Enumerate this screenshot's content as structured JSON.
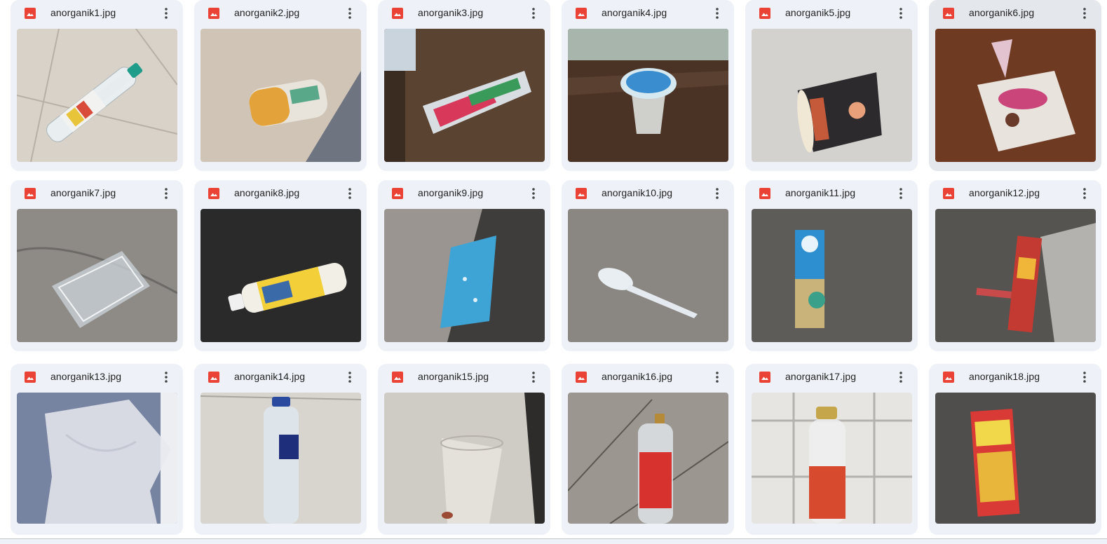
{
  "files": [
    {
      "name": "anorganik1.jpg",
      "icon": "image-file-icon",
      "menu_icon": "more-vert-icon"
    },
    {
      "name": "anorganik2.jpg",
      "icon": "image-file-icon",
      "menu_icon": "more-vert-icon"
    },
    {
      "name": "anorganik3.jpg",
      "icon": "image-file-icon",
      "menu_icon": "more-vert-icon"
    },
    {
      "name": "anorganik4.jpg",
      "icon": "image-file-icon",
      "menu_icon": "more-vert-icon"
    },
    {
      "name": "anorganik5.jpg",
      "icon": "image-file-icon",
      "menu_icon": "more-vert-icon"
    },
    {
      "name": "anorganik6.jpg",
      "icon": "image-file-icon",
      "menu_icon": "more-vert-icon"
    },
    {
      "name": "anorganik7.jpg",
      "icon": "image-file-icon",
      "menu_icon": "more-vert-icon"
    },
    {
      "name": "anorganik8.jpg",
      "icon": "image-file-icon",
      "menu_icon": "more-vert-icon"
    },
    {
      "name": "anorganik9.jpg",
      "icon": "image-file-icon",
      "menu_icon": "more-vert-icon"
    },
    {
      "name": "anorganik10.jpg",
      "icon": "image-file-icon",
      "menu_icon": "more-vert-icon"
    },
    {
      "name": "anorganik11.jpg",
      "icon": "image-file-icon",
      "menu_icon": "more-vert-icon"
    },
    {
      "name": "anorganik12.jpg",
      "icon": "image-file-icon",
      "menu_icon": "more-vert-icon"
    },
    {
      "name": "anorganik13.jpg",
      "icon": "image-file-icon",
      "menu_icon": "more-vert-icon"
    },
    {
      "name": "anorganik14.jpg",
      "icon": "image-file-icon",
      "menu_icon": "more-vert-icon"
    },
    {
      "name": "anorganik15.jpg",
      "icon": "image-file-icon",
      "menu_icon": "more-vert-icon"
    },
    {
      "name": "anorganik16.jpg",
      "icon": "image-file-icon",
      "menu_icon": "more-vert-icon"
    },
    {
      "name": "anorganik17.jpg",
      "icon": "image-file-icon",
      "menu_icon": "more-vert-icon"
    },
    {
      "name": "anorganik18.jpg",
      "icon": "image-file-icon",
      "menu_icon": "more-vert-icon"
    }
  ],
  "colors": {
    "card_background": "#eef2f8",
    "card_hover_background": "#e4e7ec",
    "file_icon": "#ea4335",
    "text": "#1f1f1f"
  }
}
